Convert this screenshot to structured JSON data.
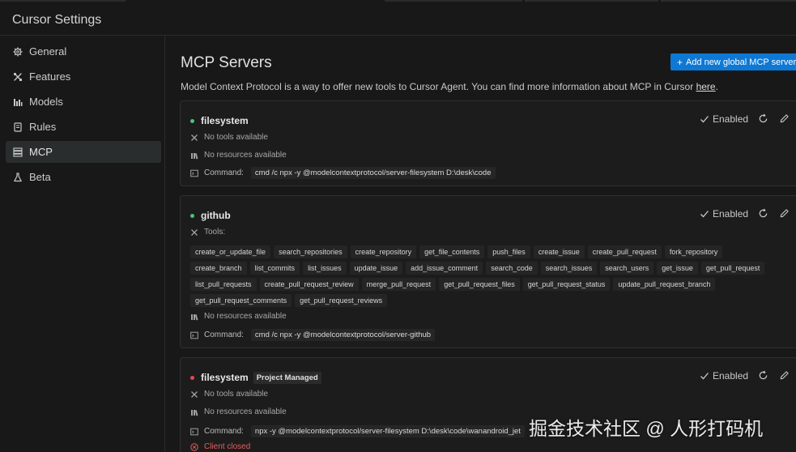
{
  "window": {
    "title": "Cursor Settings"
  },
  "sidebar": {
    "items": [
      {
        "label": "General",
        "icon": "gear-icon"
      },
      {
        "label": "Features",
        "icon": "tools-icon"
      },
      {
        "label": "Models",
        "icon": "bars-icon"
      },
      {
        "label": "Rules",
        "icon": "book-icon"
      },
      {
        "label": "MCP",
        "icon": "server-icon",
        "active": true
      },
      {
        "label": "Beta",
        "icon": "flask-icon"
      }
    ]
  },
  "main": {
    "title": "MCP Servers",
    "add_button": "Add new global MCP server",
    "description": "Model Context Protocol is a way to offer new tools to Cursor Agent. You can find more information about MCP in Cursor ",
    "description_link": "here",
    "description_end": "."
  },
  "colors": {
    "active_dot": "#4ec07a",
    "error_dot": "#e5484d",
    "accent": "#0e78d5"
  },
  "servers": [
    {
      "name": "filesystem",
      "status": "active",
      "enabled_label": "Enabled",
      "tools_text": "No tools available",
      "resources_text": "No resources available",
      "command_label": "Command:",
      "command": "cmd /c npx -y @modelcontextprotocol/server-filesystem D:\\desk\\code"
    },
    {
      "name": "github",
      "status": "active",
      "enabled_label": "Enabled",
      "tools_label": "Tools:",
      "tools": [
        "create_or_update_file",
        "search_repositories",
        "create_repository",
        "get_file_contents",
        "push_files",
        "create_issue",
        "create_pull_request",
        "fork_repository",
        "create_branch",
        "list_commits",
        "list_issues",
        "update_issue",
        "add_issue_comment",
        "search_code",
        "search_issues",
        "search_users",
        "get_issue",
        "get_pull_request",
        "list_pull_requests",
        "create_pull_request_review",
        "merge_pull_request",
        "get_pull_request_files",
        "get_pull_request_status",
        "update_pull_request_branch",
        "get_pull_request_comments",
        "get_pull_request_reviews"
      ],
      "resources_text": "No resources available",
      "command_label": "Command:",
      "command": "cmd /c npx -y @modelcontextprotocol/server-github"
    },
    {
      "name": "filesystem",
      "status": "error",
      "badge": "Project Managed",
      "enabled_label": "Enabled",
      "tools_text": "No tools available",
      "resources_text": "No resources available",
      "command_label": "Command:",
      "command": "npx -y @modelcontextprotocol/server-filesystem D:\\desk\\code\\wanandroid_jet",
      "error_text": "Client closed"
    }
  ],
  "watermark": "掘金技术社区 @ 人形打码机"
}
